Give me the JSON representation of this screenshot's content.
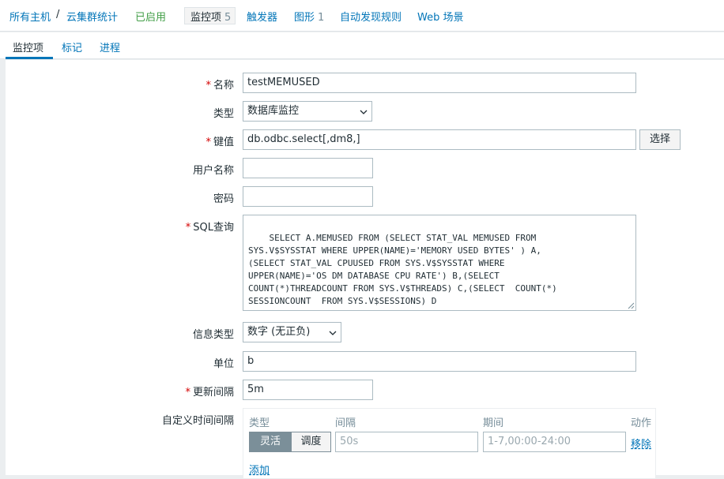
{
  "breadcrumb": {
    "all_hosts": "所有主机",
    "separator": "/",
    "host": "云集群统计",
    "status": "已启用",
    "items_label": "监控项",
    "items_count": "5",
    "triggers": "触发器",
    "graphs_label": "图形",
    "graphs_count": "1",
    "discovery": "自动发现规则",
    "web": "Web 场景"
  },
  "tabs": {
    "item": "监控项",
    "tags": "标记",
    "preprocessing": "进程"
  },
  "form": {
    "name_label": "名称",
    "name_value": "testMEMUSED",
    "type_label": "类型",
    "type_value": "数据库监控",
    "key_label": "键值",
    "key_value": "db.odbc.select[,dm8,]",
    "select_button": "选择",
    "username_label": "用户名称",
    "username_value": "",
    "password_label": "密码",
    "password_value": "",
    "sql_label": "SQL查询",
    "sql_value": "SELECT A.MEMUSED FROM (SELECT STAT_VAL MEMUSED FROM\nSYS.V$SYSSTAT WHERE UPPER(NAME)='MEMORY USED BYTES' ) A,\n(SELECT STAT_VAL CPUUSED FROM SYS.V$SYSSTAT WHERE\nUPPER(NAME)='OS DM DATABASE CPU RATE') B,(SELECT\nCOUNT(*)THREADCOUNT FROM SYS.V$THREADS) C,(SELECT  COUNT(*)\nSESSIONCOUNT  FROM SYS.V$SESSIONS) D",
    "info_type_label": "信息类型",
    "info_type_value": "数字 (无正负)",
    "units_label": "单位",
    "units_value": "b",
    "interval_label": "更新间隔",
    "interval_value": "5m",
    "custom_label": "自定义时间间隔",
    "custom": {
      "col_type": "类型",
      "col_interval": "间隔",
      "col_period": "期间",
      "col_action": "动作",
      "flexible": "灵活",
      "scheduling": "调度",
      "interval_placeholder": "50s",
      "period_placeholder": "1-7,00:00-24:00",
      "remove": "移除",
      "add": "添加"
    }
  },
  "colors": {
    "link": "#0275b8",
    "enabled": "#429e47",
    "required": "#d40000",
    "segment_active": "#7b8f99"
  },
  "icons": {
    "dropdown": "chevron-down-icon",
    "resize": "resize-handle-icon"
  }
}
